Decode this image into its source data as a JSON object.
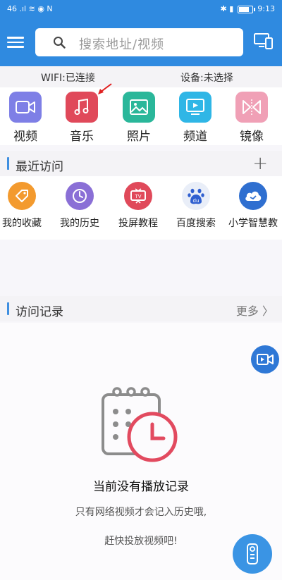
{
  "status_bar": {
    "left_indicators": "46 .ıl ≋ ◉ N",
    "right_indicators": "✱ ▮",
    "time": "9:13"
  },
  "header": {
    "search_placeholder": "搜索地址/视频"
  },
  "info_row": {
    "wifi": "WIFI:已连接",
    "device": "设备:未选择"
  },
  "categories": [
    {
      "label": "视频",
      "icon": "video-camera-icon",
      "color": "#7e7fe6"
    },
    {
      "label": "音乐",
      "icon": "music-note-icon",
      "color": "#e0495a"
    },
    {
      "label": "照片",
      "icon": "photo-icon",
      "color": "#2ab79a"
    },
    {
      "label": "频道",
      "icon": "tv-play-icon",
      "color": "#2fb6e6"
    },
    {
      "label": "镜像",
      "icon": "mirror-icon",
      "color": "#f0a0b6"
    }
  ],
  "recent_section": {
    "title": "最近访问"
  },
  "recent_items": [
    {
      "label": "我的收藏",
      "icon": "tag-icon",
      "color": "#f39a2e"
    },
    {
      "label": "我的历史",
      "icon": "clock-icon",
      "color": "#8a6fd6"
    },
    {
      "label": "投屏教程",
      "icon": "tv-icon",
      "color": "#e0495a"
    },
    {
      "label": "百度搜索",
      "icon": "baidu-paw-icon",
      "color": "#2f78d6"
    },
    {
      "label": "小学智慧教",
      "icon": "cloud-book-icon",
      "color": "#2f6fd0"
    }
  ],
  "history_section": {
    "title": "访问记录",
    "more": "更多"
  },
  "empty_state": {
    "title": "当前没有播放记录",
    "line1": "只有网络视频才会记入历史哦,",
    "line2": "赶快投放视频吧!"
  }
}
